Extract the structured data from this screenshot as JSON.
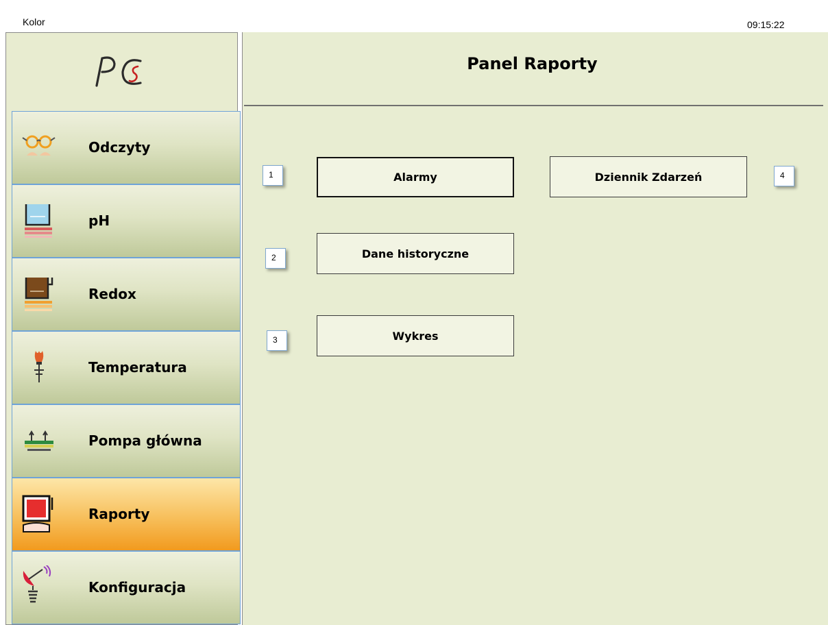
{
  "window": {
    "title": "Kolor",
    "clock": "09:15:22"
  },
  "logo": {
    "text": "PCS"
  },
  "sidebar": {
    "items": [
      {
        "label": "Odczyty",
        "icon": "glasses-icon",
        "active": false
      },
      {
        "label": "pH",
        "icon": "ph-beaker-icon",
        "active": false
      },
      {
        "label": "Redox",
        "icon": "redox-beaker-icon",
        "active": false
      },
      {
        "label": "Temperatura",
        "icon": "thermometer-icon",
        "active": false
      },
      {
        "label": "Pompa główna",
        "icon": "pump-icon",
        "active": false
      },
      {
        "label": "Raporty",
        "icon": "report-icon",
        "active": true
      },
      {
        "label": "Konfiguracja",
        "icon": "satellite-dish-icon",
        "active": false
      }
    ]
  },
  "panel": {
    "title": "Panel Raporty",
    "buttons": [
      {
        "label": "Alarmy",
        "number": "1",
        "focused": true
      },
      {
        "label": "Dane historyczne",
        "number": "2",
        "focused": false
      },
      {
        "label": "Wykres",
        "number": "3",
        "focused": false
      },
      {
        "label": "Dziennik Zdarzeń",
        "number": "4",
        "focused": false
      }
    ]
  },
  "colors": {
    "panel_bg": "#e8edd2",
    "nav_active": "#f29a1e",
    "nav_border": "#6ea3d8"
  }
}
